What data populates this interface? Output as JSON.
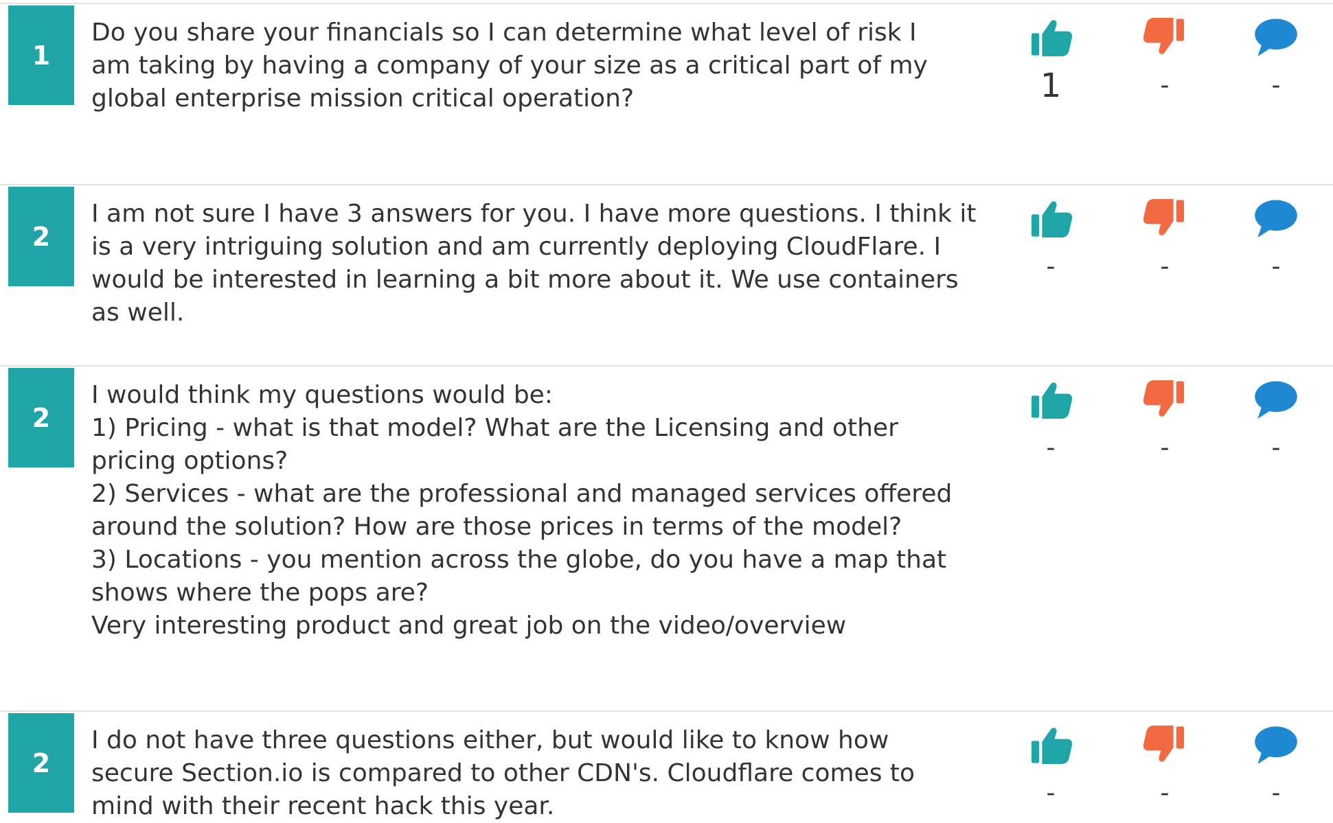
{
  "colors": {
    "badge": "#1fa4a8",
    "thumbs_up": "#1fa4a8",
    "thumbs_down": "#f26a41",
    "comment": "#1e88d3",
    "divider": "#e2e2e2",
    "text": "#333333"
  },
  "icons": {
    "up": "thumbs-up-icon",
    "down": "thumbs-down-icon",
    "comment": "speech-bubble-icon"
  },
  "responses": [
    {
      "score": "1",
      "text": "Do you share your financials so I can determine what level of risk I am taking by having a company of your size as a critical part of my global enterprise mission critical operation?",
      "upvotes": "1",
      "downvotes": "-",
      "comments": "-"
    },
    {
      "score": "2",
      "text": "I am not sure I have 3 answers for you.  I have more questions.  I think it is a very intriguing solution and am currently deploying CloudFlare.  I would be interested in learning a bit more about it.  We use containers as well.",
      "upvotes": "-",
      "downvotes": "-",
      "comments": "-"
    },
    {
      "score": "2",
      "text": "I would think my questions would be:\n1) Pricing - what is that model? What are the Licensing and other pricing options?\n2) Services - what are the professional and managed services offered around the solution? How are those prices in terms of the model?\n3) Locations - you mention across the globe, do you have a map that shows where the pops are?\nVery interesting product and great job on the video/overview",
      "upvotes": "-",
      "downvotes": "-",
      "comments": "-"
    },
    {
      "score": "2",
      "text": "I do not have three questions either, but would like to know how secure Section.io is compared to other CDN's. Cloudflare comes to mind with their recent hack this year.",
      "upvotes": "-",
      "downvotes": "-",
      "comments": "-"
    }
  ]
}
